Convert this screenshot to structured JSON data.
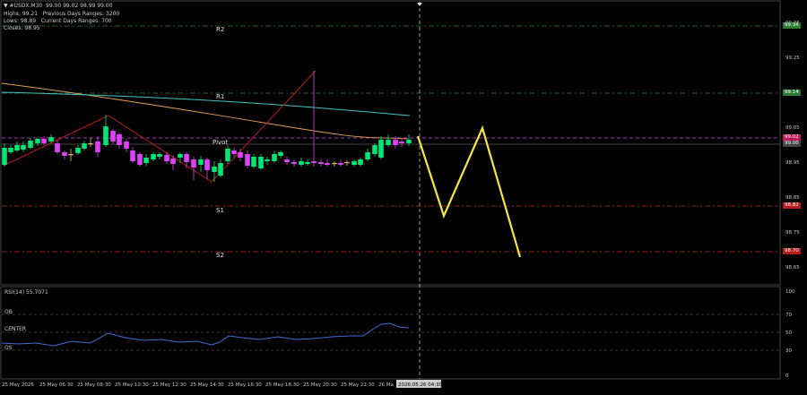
{
  "header": {
    "symbol_line": "▼ #USDX,M30  99.00 99.02 98.99 99.00",
    "highs": "Highs: 99.21",
    "prev_range": "Previous Days Ranges: 3200",
    "lows": "Lows: 98.89",
    "cur_range": "Current Days Ranges: 700",
    "closes": "Closes: 98.95"
  },
  "levels": {
    "r2": "R2",
    "r1": "R1",
    "pivot": "Pivot",
    "s1": "S1",
    "s2": "S2"
  },
  "price_tags": {
    "r2": "99.34",
    "r1": "99.14",
    "pivot": "99.02",
    "current": "99.00",
    "s1": "98.82",
    "s2": "98.70"
  },
  "price_axis": [
    "99.35",
    "99.25",
    "99.15",
    "99.05",
    "98.95",
    "98.85",
    "98.75",
    "98.65"
  ],
  "rsi": {
    "label": "RSI(14) 55.7071",
    "ob": "OB",
    "center": "CENTER",
    "os": "OS",
    "axis": [
      "100",
      "70",
      "50",
      "30",
      "0"
    ]
  },
  "time_axis": [
    "25 May 2026",
    "25 May 06:30",
    "25 May 08:30",
    "25 May 10:30",
    "25 May 12:30",
    "25 May 14:30",
    "25 May 16:30",
    "25 May 18:30",
    "25 May 20:30",
    "25 May 22:30",
    "26 Ma"
  ],
  "time_cursor": "2026.05.26 04:30",
  "colors": {
    "bull": "#00e676",
    "bear": "#e040fb",
    "forecast": "#f5e642",
    "ma_slow": "#40c4c4",
    "ma_fast": "#e0a050",
    "zigzag": "#b71c1c",
    "resistance": "#2e7d32",
    "support": "#c62828",
    "pivot": "#e040fb",
    "rsi_line": "#3d6fd6"
  }
}
